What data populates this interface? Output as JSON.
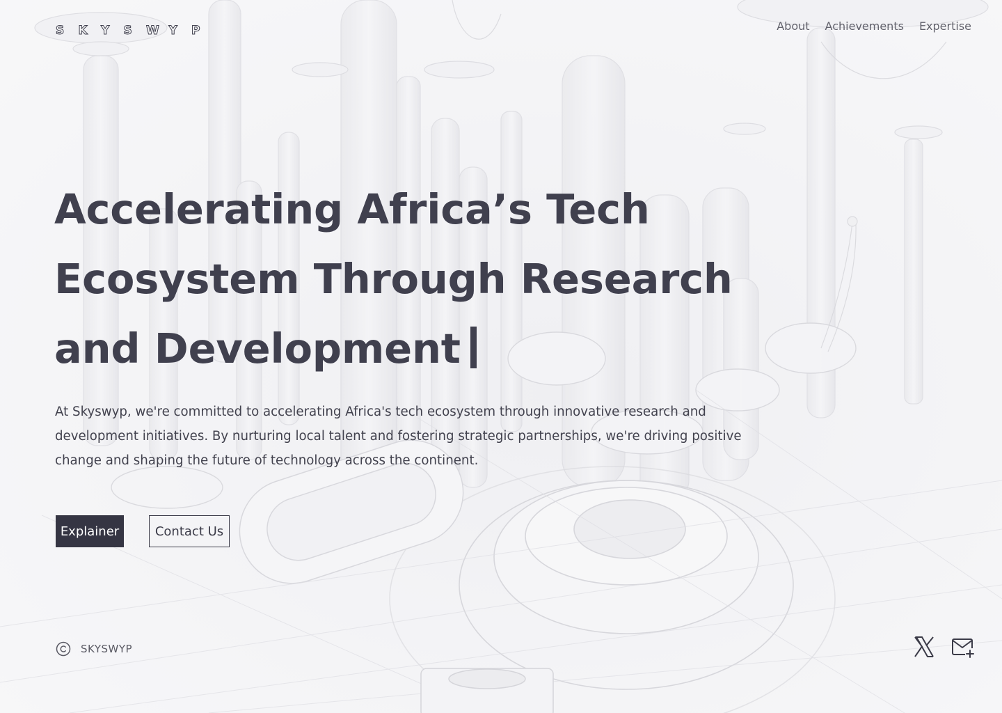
{
  "brand": {
    "logo_letters": [
      "S",
      "K",
      "Y",
      "S",
      "W",
      "Y",
      "P"
    ],
    "footer_name": "SKYSWYP",
    "copyright_symbol": "©"
  },
  "nav": {
    "items": [
      {
        "label": "About"
      },
      {
        "label": "Achievements"
      },
      {
        "label": "Expertise"
      }
    ]
  },
  "hero": {
    "headline_lines": [
      "Accelerating Africa’s Tech",
      "Ecosystem Through Research",
      "and Development"
    ],
    "description": "At Skyswyp, we're committed to accelerating Africa's tech ecosystem through innovative research and development initiatives. By nurturing local talent and fostering strategic partnerships, we're driving positive change and shaping the future of technology across the continent.",
    "primary_button": "Explainer",
    "secondary_button": "Contact Us"
  },
  "footer": {
    "social_icons": [
      "x-icon",
      "mail-plus-icon"
    ]
  },
  "colors": {
    "text_dark": "#40404e",
    "button_dark": "#353543",
    "background": "#f6f6f7"
  }
}
